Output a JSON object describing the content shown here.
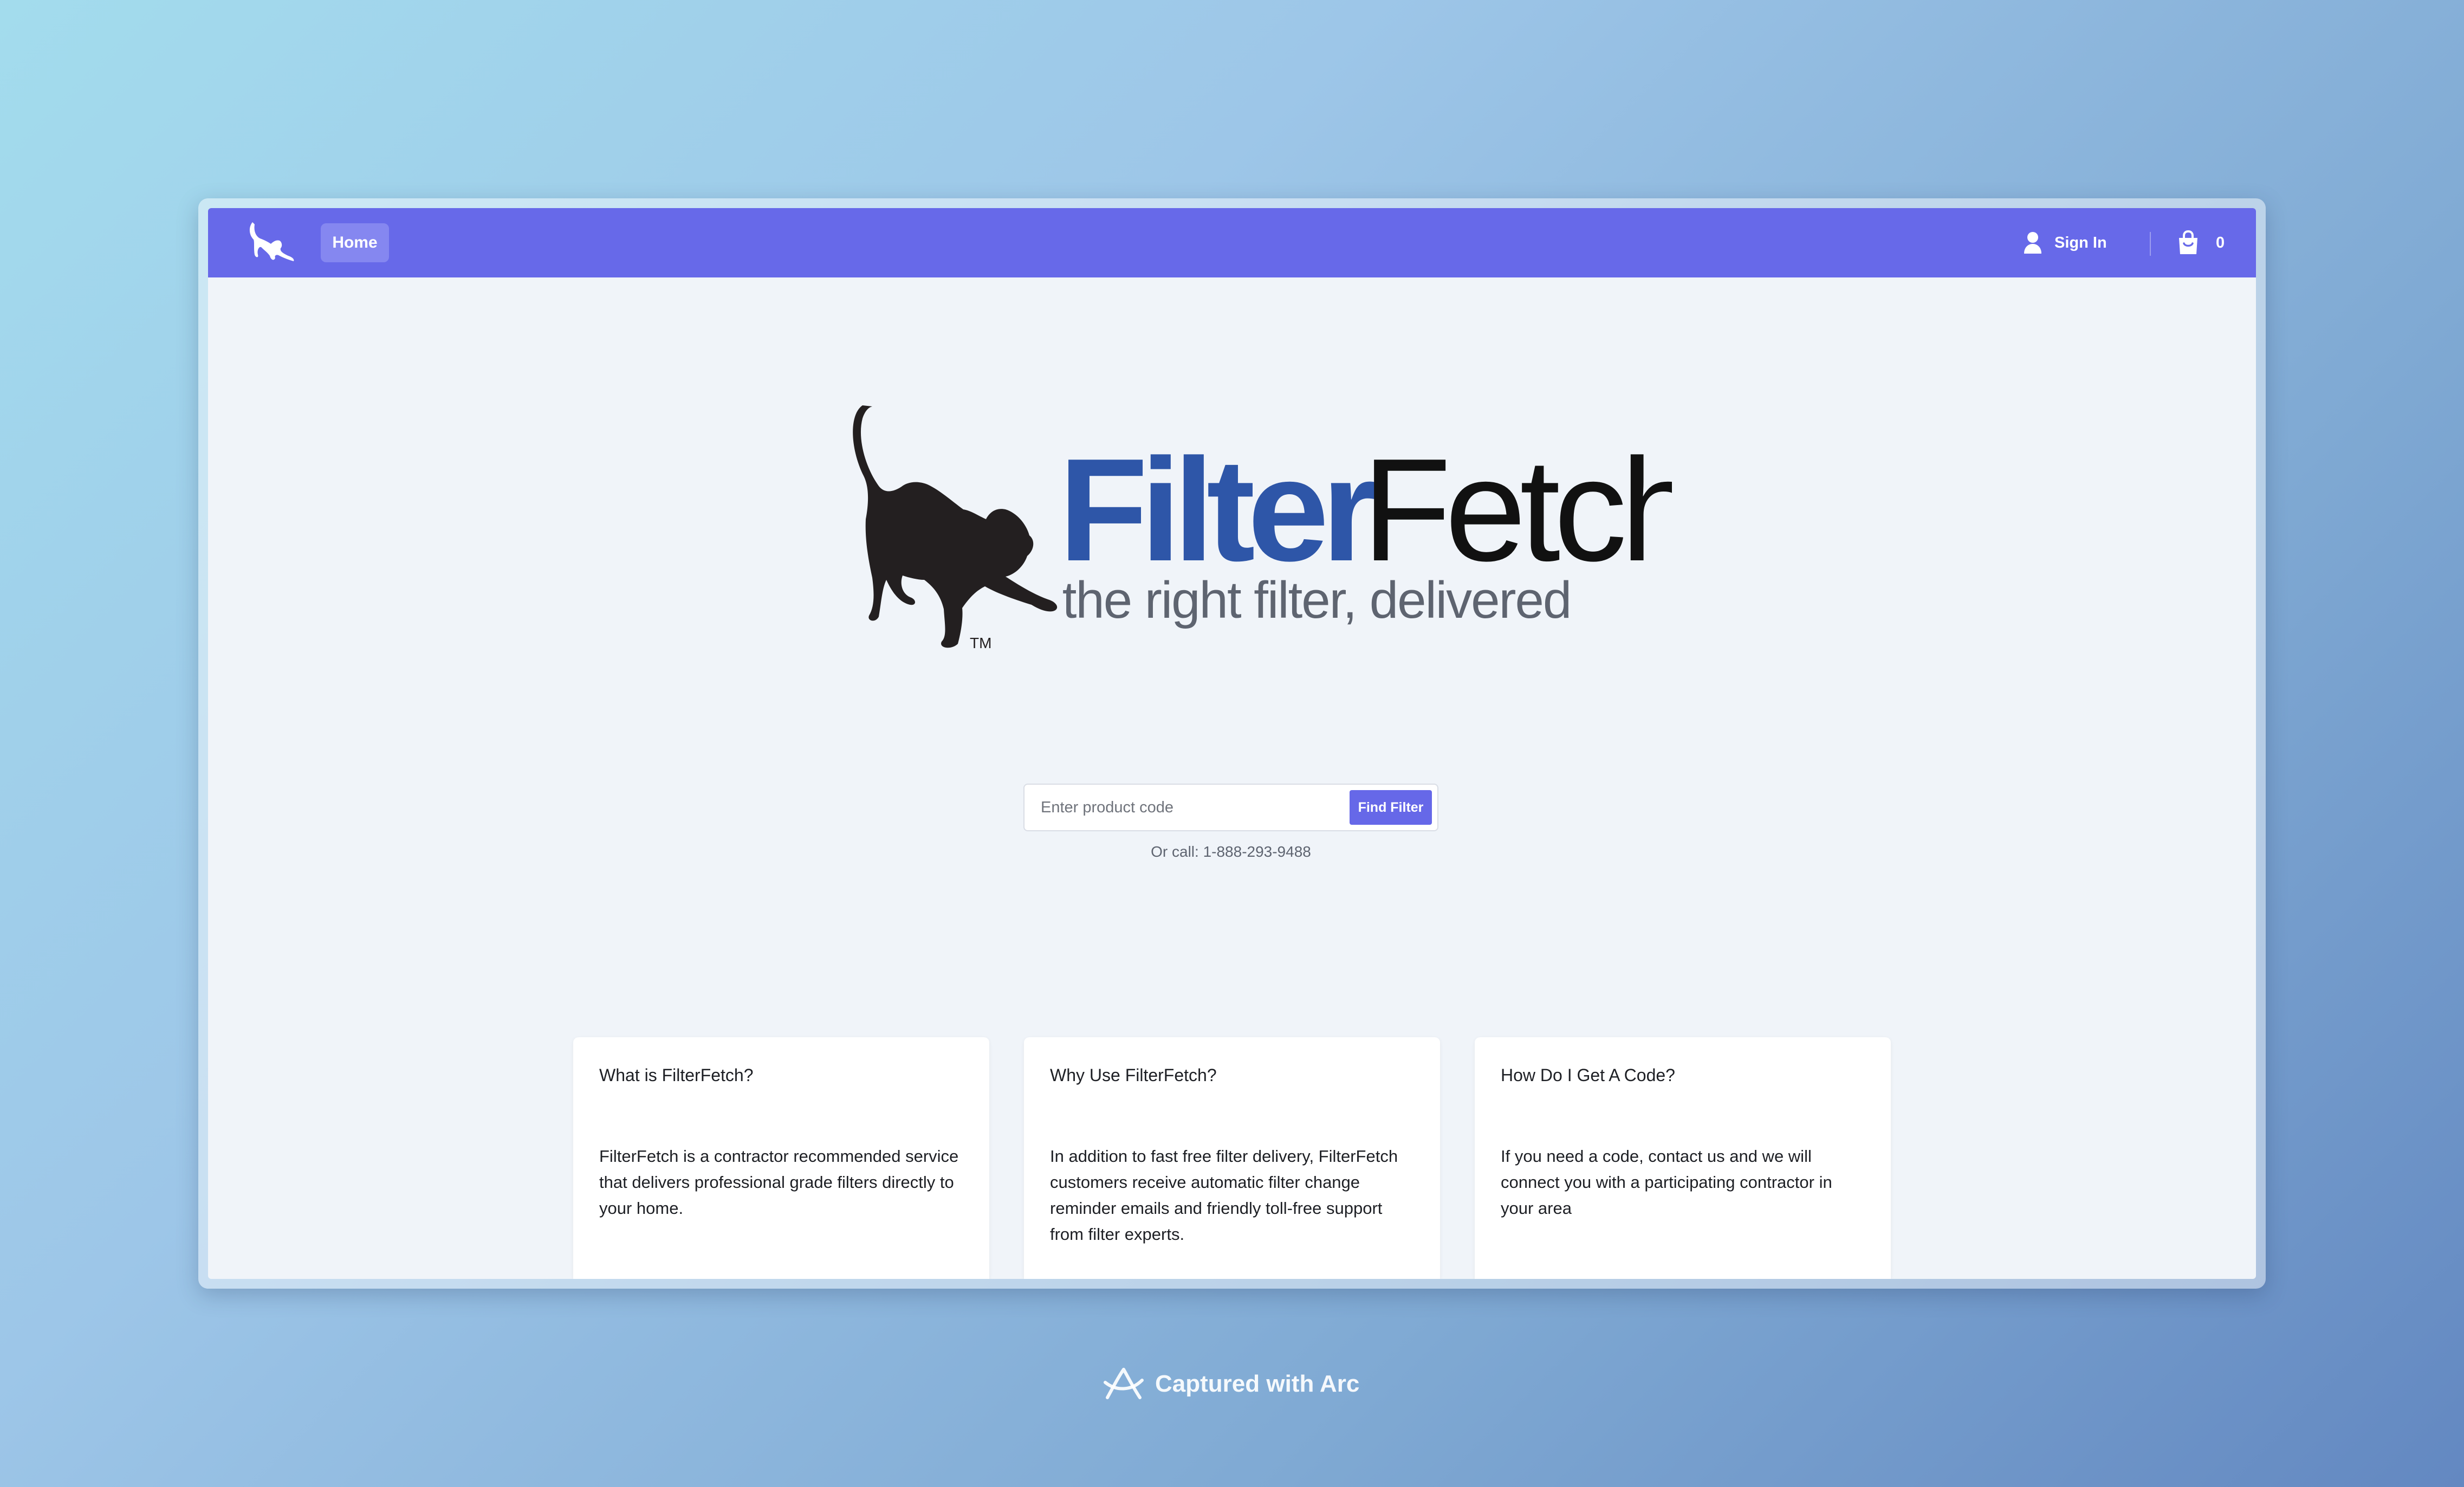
{
  "nav": {
    "home_label": "Home",
    "signin_label": "Sign In",
    "cart_count": "0"
  },
  "hero": {
    "brand_part1": "Filter",
    "brand_part2": "Fetch",
    "tagline": "the right filter, delivered",
    "trademark": "TM"
  },
  "search": {
    "placeholder": "Enter product code",
    "value": "",
    "button_label": "Find Filter",
    "call_text": "Or call: 1-888-293-9488"
  },
  "cards": [
    {
      "title": "What is FilterFetch?",
      "body": "FilterFetch is a contractor recommended service that delivers professional grade filters directly to your home."
    },
    {
      "title": "Why Use FilterFetch?",
      "body": "In addition to fast free filter delivery, FilterFetch customers receive automatic filter change reminder emails and friendly toll-free support from filter experts."
    },
    {
      "title": "How Do I Get A Code?",
      "body": "If you need a code, contact us and we will connect you with a participating contractor in your area"
    }
  ],
  "footer": {
    "capture_label": "Captured with Arc"
  },
  "colors": {
    "nav_bg": "#6769e9",
    "brand_blue": "#2e56a8",
    "accent_button": "#6668e8",
    "page_bg": "#f0f4f9"
  },
  "icons": {
    "nav_logo": "dog-logo-icon",
    "signin": "user-icon",
    "cart": "shopping-bag-icon",
    "footer": "arc-logo-icon"
  }
}
